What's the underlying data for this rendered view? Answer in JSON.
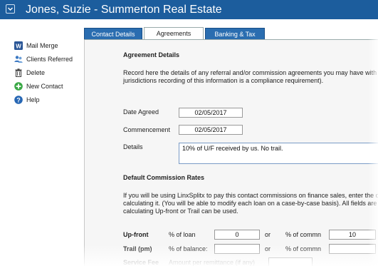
{
  "window": {
    "title": "Jones, Suzie - Summerton Real Estate"
  },
  "sidebar": {
    "items": [
      {
        "label": "Mail Merge",
        "icon": "word-icon"
      },
      {
        "label": "Clients Referred",
        "icon": "users-icon"
      },
      {
        "label": "Delete",
        "icon": "trash-icon"
      },
      {
        "label": "New Contact",
        "icon": "add-icon"
      },
      {
        "label": "Help",
        "icon": "help-icon"
      }
    ]
  },
  "tabs": [
    {
      "label": "Contact Details",
      "active": false
    },
    {
      "label": "Agreements",
      "active": true
    },
    {
      "label": "Banking & Tax",
      "active": false
    }
  ],
  "agreement": {
    "heading": "Agreement Details",
    "desc_line1": "Record here the details of any referral and/or commission agreements you may have with",
    "desc_line2": "jurisdictions recording of this information is a compliance requirement).",
    "date_agreed_label": "Date Agreed",
    "date_agreed_value": "02/05/2017",
    "commencement_label": "Commencement",
    "commencement_value": "02/05/2017",
    "details_label": "Details",
    "details_value": "10% of U/F received by us. No trail."
  },
  "commission": {
    "heading": "Default Commission Rates",
    "desc_line1": "If you will be using LinxSplitx to pay this contact commissions on finance sales, enter the d",
    "desc_line2": "calculating it. (You will be able to modify each loan on a case-by-case basis). All fields are",
    "desc_line3": "calculating Up-front or Trail can be used.",
    "upfront_label": "Up-front",
    "upfront_pct_loan_label": "% of loan",
    "upfront_pct_loan_value": "0",
    "or1": "or",
    "upfront_pct_commn_label": "% of commn",
    "upfront_pct_commn_value": "10",
    "trail_label": "Trail (pm)",
    "trail_pct_balance_label": "% of balance:",
    "trail_pct_balance_value": "",
    "or2": "or",
    "trail_pct_commn_label": "% of commn",
    "trail_pct_commn_value": "",
    "service_fee_label": "Service Fee",
    "service_fee_amount_label": "Amount per remittance (if any)",
    "service_fee_value": ""
  },
  "colors": {
    "titlebar": "#1c5d9d",
    "tab_inactive": "#2a6db0",
    "panel_bg": "#f6f6f6"
  }
}
